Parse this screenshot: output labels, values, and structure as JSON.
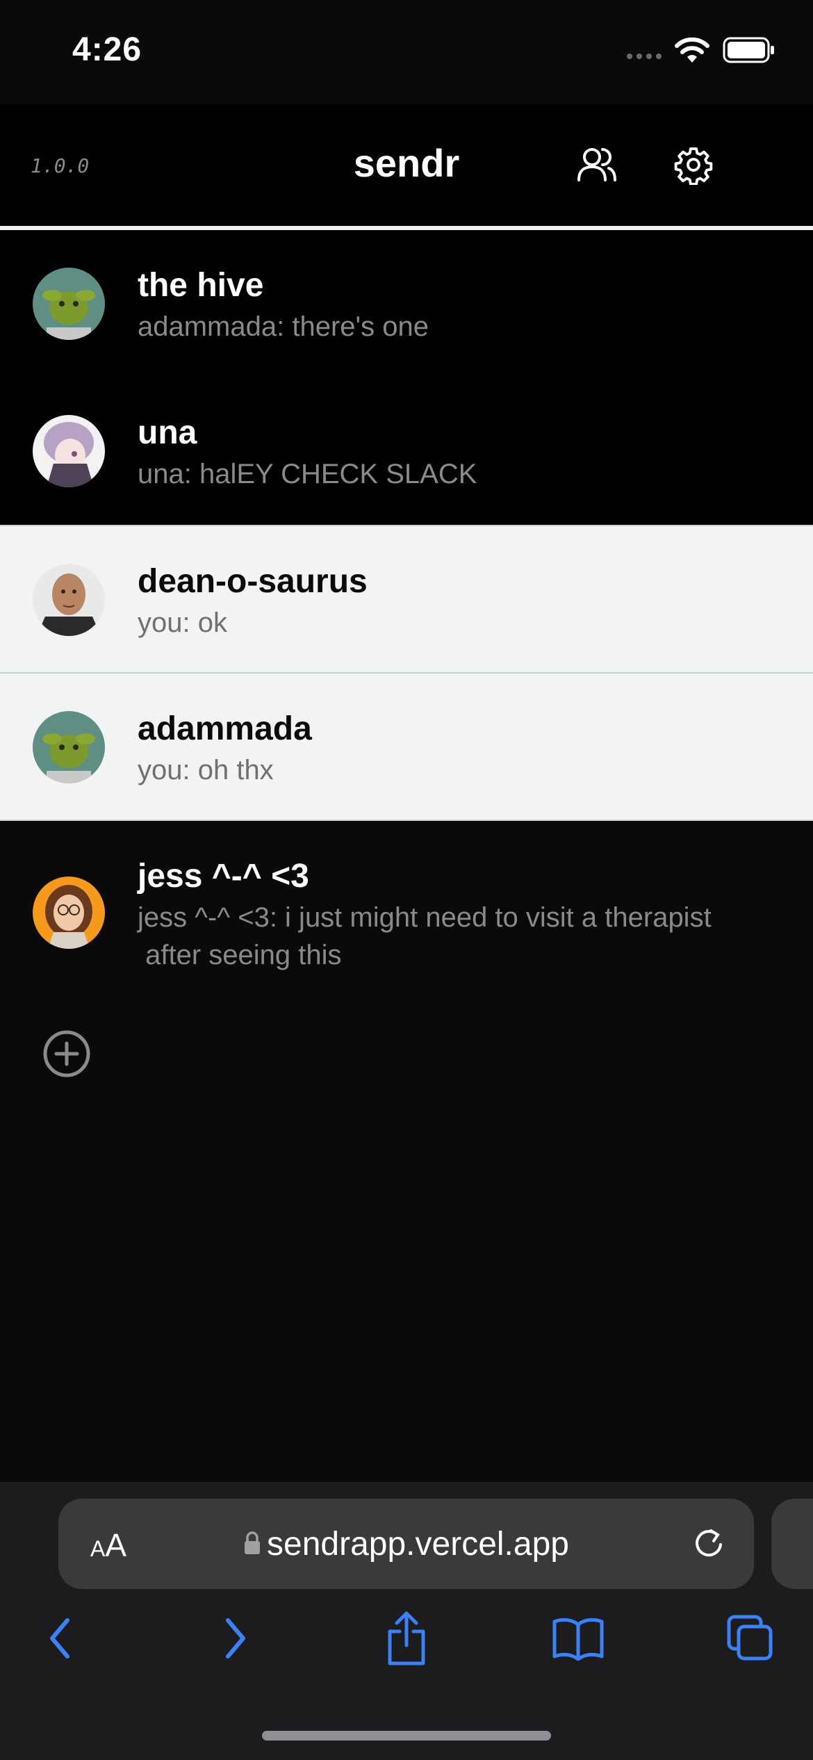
{
  "status_bar": {
    "time": "4:26"
  },
  "header": {
    "version": "1.0.0",
    "title": "sendr",
    "icons": [
      "friends-icon",
      "settings-icon"
    ]
  },
  "chats": [
    {
      "name": "the hive",
      "preview": "adammada: there's one",
      "avatar": "goblin-avatar"
    },
    {
      "name": "una",
      "preview": "una: halEY CHECK SLACK",
      "avatar": "anime-girl-avatar"
    },
    {
      "name": "dean-o-saurus",
      "preview": "you: ok",
      "avatar": "bald-man-avatar"
    },
    {
      "name": "adammada",
      "preview": "you: oh thx",
      "avatar": "goblin-avatar"
    },
    {
      "name": "jess ^-^ <3",
      "preview": "jess ^-^ <3: i just might need to visit a therapist\n after seeing this",
      "avatar": "cartoon-girl-avatar"
    }
  ],
  "safari": {
    "text_size_label": "AA",
    "url": "sendrapp.vercel.app"
  },
  "colors": {
    "background": "#000000",
    "highlight_row": "#f2f4f4",
    "toolbar_accent": "#3b82f6"
  }
}
